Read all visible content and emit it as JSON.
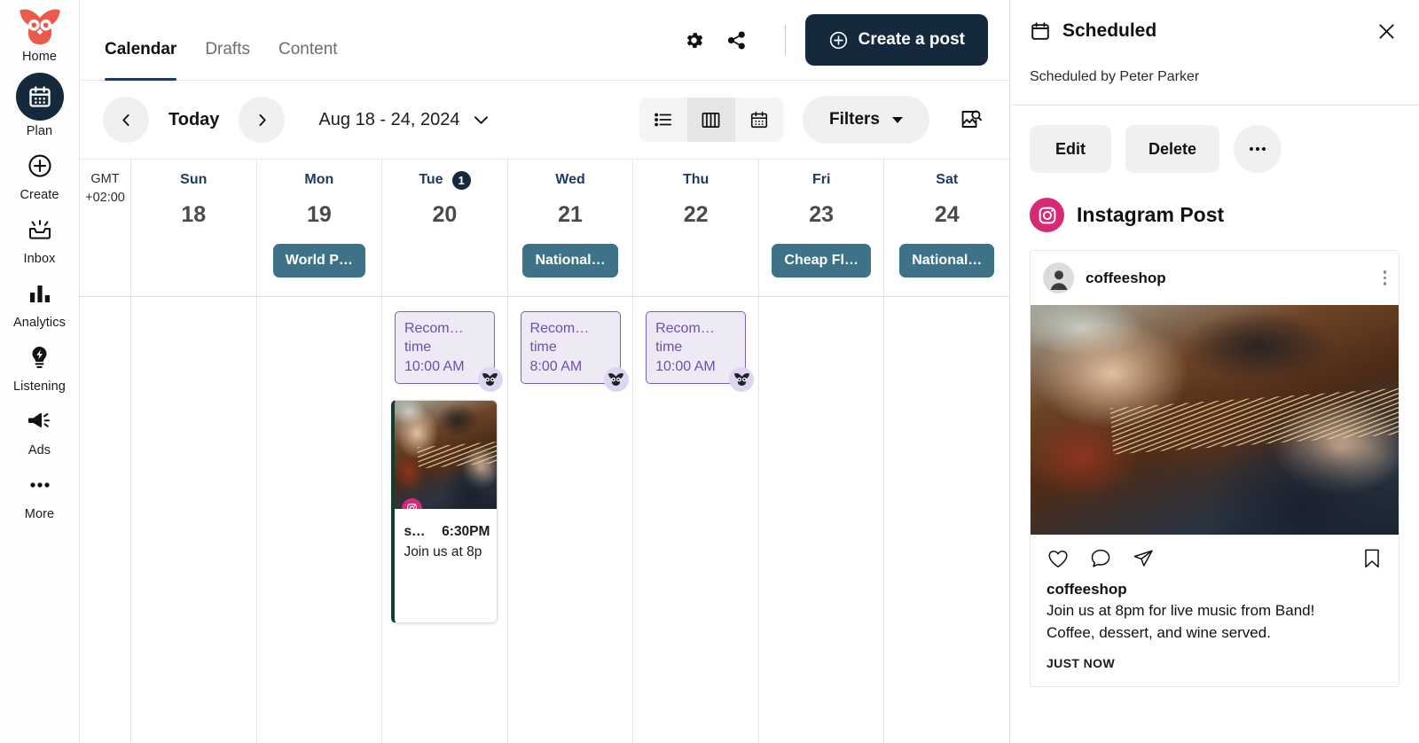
{
  "sidebar": {
    "logo_icon": "owl-logo",
    "items": [
      {
        "label": "Home",
        "icon": "owl-logo",
        "active": false
      },
      {
        "label": "Plan",
        "icon": "calendar-icon",
        "active": true
      },
      {
        "label": "Create",
        "icon": "plus-circle-icon",
        "active": false
      },
      {
        "label": "Inbox",
        "icon": "inbox-icon",
        "active": false
      },
      {
        "label": "Analytics",
        "icon": "bar-chart-icon",
        "active": false
      },
      {
        "label": "Listening",
        "icon": "lightbulb-icon",
        "active": false
      },
      {
        "label": "Ads",
        "icon": "megaphone-icon",
        "active": false
      },
      {
        "label": "More",
        "icon": "ellipsis-icon",
        "active": false
      }
    ]
  },
  "topbar": {
    "tabs": [
      {
        "label": "Calendar",
        "active": true
      },
      {
        "label": "Drafts",
        "active": false
      },
      {
        "label": "Content",
        "active": false
      }
    ],
    "settings_icon": "gear-icon",
    "share_icon": "share-icon",
    "create_post_label": "Create a post",
    "create_post_icon": "plus-circle-icon"
  },
  "toolbar": {
    "prev_icon": "chevron-left-icon",
    "next_icon": "chevron-right-icon",
    "today_label": "Today",
    "date_range": "Aug 18 - 24, 2024",
    "date_dropdown_icon": "chevron-down-icon",
    "views": [
      {
        "name": "list-view",
        "icon": "list-icon",
        "active": false
      },
      {
        "name": "week-view",
        "icon": "columns-icon",
        "active": true
      },
      {
        "name": "month-view",
        "icon": "calendar-icon",
        "active": false
      }
    ],
    "filters_label": "Filters",
    "media_search_icon": "image-search-icon"
  },
  "calendar": {
    "timezone": "GMT\n+02:00",
    "timezone_line1": "GMT",
    "timezone_line2": "+02:00",
    "days": [
      {
        "dow": "Sun",
        "date": "18",
        "badge": "",
        "event": ""
      },
      {
        "dow": "Mon",
        "date": "19",
        "badge": "",
        "event": "World P…"
      },
      {
        "dow": "Tue",
        "date": "20",
        "badge": "1",
        "event": ""
      },
      {
        "dow": "Wed",
        "date": "21",
        "badge": "",
        "event": "National…"
      },
      {
        "dow": "Thu",
        "date": "22",
        "badge": "",
        "event": ""
      },
      {
        "dow": "Fri",
        "date": "23",
        "badge": "",
        "event": "Cheap Fl…"
      },
      {
        "dow": "Sat",
        "date": "24",
        "badge": "",
        "event": "National…"
      }
    ],
    "recommended": [
      {
        "day_index": 2,
        "line1": "Recom…",
        "line2": "time",
        "time": "10:00 AM"
      },
      {
        "day_index": 3,
        "line1": "Recom…",
        "line2": "time",
        "time": "8:00 AM"
      },
      {
        "day_index": 4,
        "line1": "Recom…",
        "line2": "time",
        "time": "10:00 AM"
      }
    ],
    "post_card": {
      "day_index": 2,
      "network_icon": "instagram-icon",
      "name": "s…",
      "time": "6:30PM",
      "text": "Join us at 8p"
    }
  },
  "panel": {
    "calendar_icon": "calendar-icon",
    "title": "Scheduled",
    "close_icon": "close-icon",
    "subtitle": "Scheduled by Peter Parker",
    "edit_label": "Edit",
    "delete_label": "Delete",
    "more_icon": "ellipsis-icon",
    "network_icon": "instagram-icon",
    "network_label": "Instagram Post",
    "post": {
      "avatar_icon": "user-avatar-icon",
      "username": "coffeeshop",
      "more_icon": "kebab-menu-icon",
      "like_icon": "heart-icon",
      "comment_icon": "comment-icon",
      "share_icon": "paper-plane-icon",
      "bookmark_icon": "bookmark-icon",
      "caption_author": "coffeeshop",
      "caption_line1": "Join us at 8pm for live music from Band!",
      "caption_line2": "Coffee, dessert, and wine served.",
      "timestamp": "JUST NOW"
    }
  },
  "colors": {
    "brand_dark": "#14293c",
    "accent_purple": "#6d4fb0",
    "event_chip": "#3e7387",
    "instagram": "#d62976",
    "post_accent": "#153d2e",
    "owl_red": "#ec5a4c"
  }
}
